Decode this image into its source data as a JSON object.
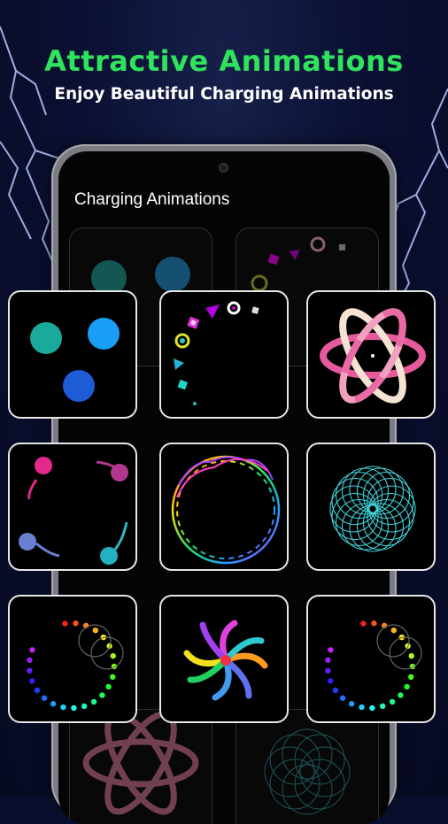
{
  "header": {
    "headline": "Attractive Animations",
    "subtitle": "Enjoy Beautiful Charging Animations"
  },
  "screen": {
    "title": "Charging Animations"
  },
  "colors": {
    "headline": "#2fe35d",
    "background": "#0b1033",
    "card_border": "#e7e7e7"
  },
  "animations": [
    {
      "name": "three-dots"
    },
    {
      "name": "shapes-circle"
    },
    {
      "name": "atom-pink"
    },
    {
      "name": "comet-dots"
    },
    {
      "name": "rainbow-wave-ring"
    },
    {
      "name": "spirograph-cyan"
    },
    {
      "name": "rainbow-dots-ring"
    },
    {
      "name": "swirl-pinwheel"
    },
    {
      "name": "rainbow-dots-ring-2"
    }
  ]
}
